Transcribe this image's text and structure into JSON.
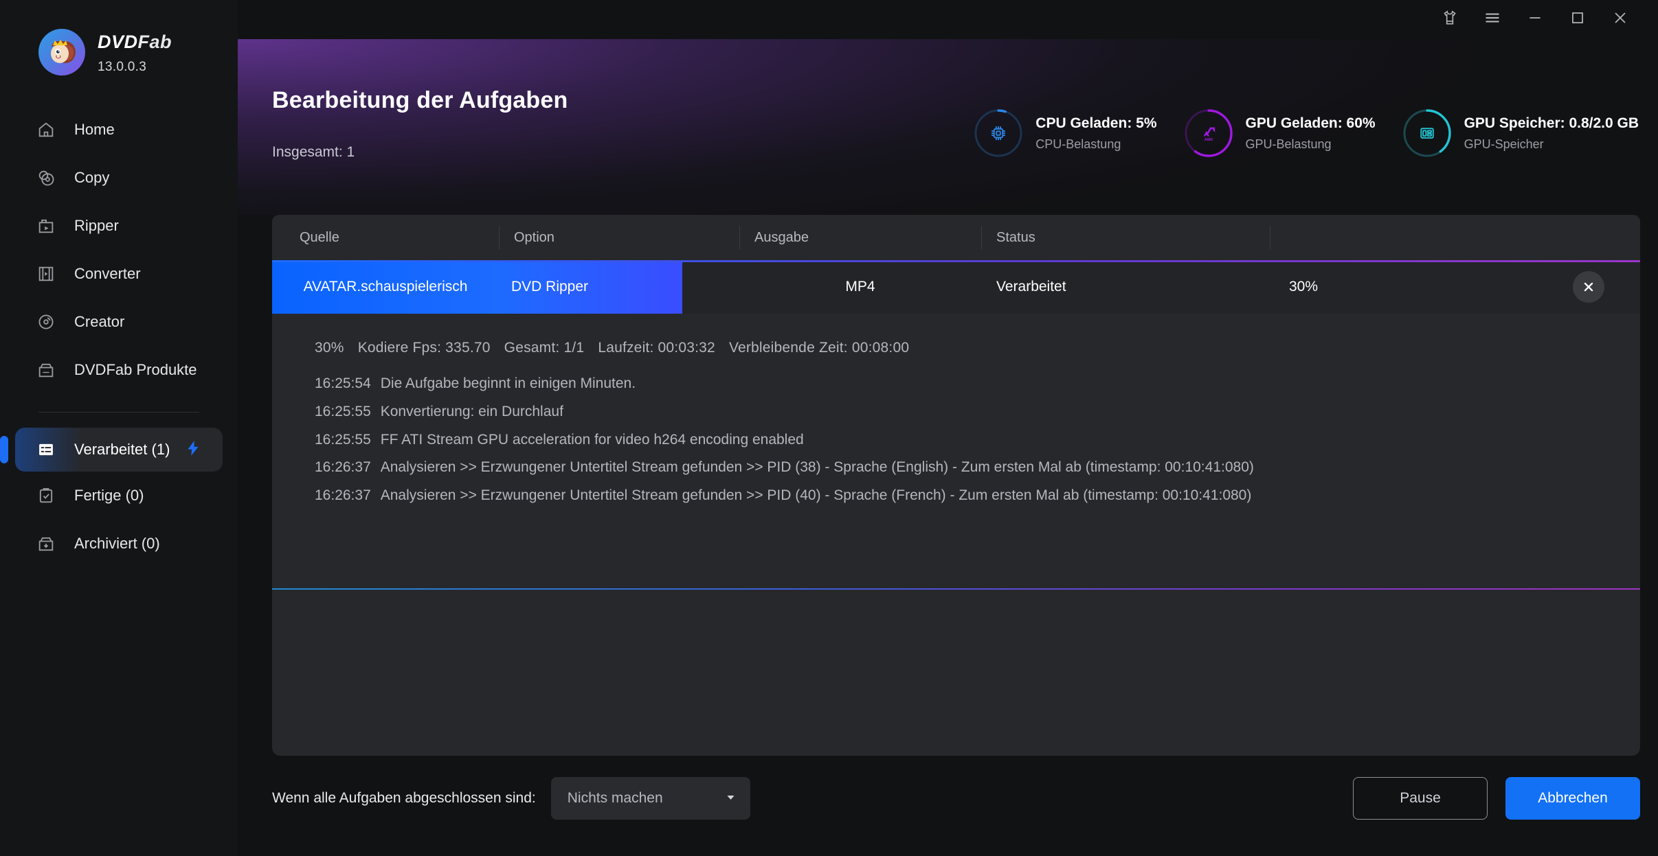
{
  "brand": {
    "name_dvd": "DVD",
    "name_fab": "Fab",
    "version": "13.0.0.3",
    "logo_icon": "monkey-mascot-logo"
  },
  "titlebar": {
    "buttons": [
      {
        "icon": "theme-shirt-icon",
        "name": "theme-button"
      },
      {
        "icon": "hamburger-menu-icon",
        "name": "menu-button"
      },
      {
        "icon": "minimize-icon",
        "name": "minimize-button"
      },
      {
        "icon": "maximize-icon",
        "name": "maximize-button"
      },
      {
        "icon": "close-icon",
        "name": "close-button"
      }
    ]
  },
  "sidebar": {
    "items": [
      {
        "label": "Home",
        "icon": "home-icon"
      },
      {
        "label": "Copy",
        "icon": "disc-copy-icon"
      },
      {
        "label": "Ripper",
        "icon": "ripper-folder-icon"
      },
      {
        "label": "Converter",
        "icon": "film-strip-icon"
      },
      {
        "label": "Creator",
        "icon": "disc-creator-icon"
      },
      {
        "label": "DVDFab Produkte",
        "icon": "products-box-icon"
      }
    ],
    "queue": [
      {
        "label": "Verarbeitet (1)",
        "icon": "processing-list-icon",
        "active": true,
        "badge_icon": "lightning-bolt-icon"
      },
      {
        "label": "Fertige (0)",
        "icon": "clipboard-check-icon",
        "active": false
      },
      {
        "label": "Archiviert (0)",
        "icon": "archive-box-icon",
        "active": false
      }
    ]
  },
  "header": {
    "title": "Bearbeitung der Aufgaben",
    "total": "Insgesamt: 1"
  },
  "stats": [
    {
      "title": "CPU Geladen: 5%",
      "subtitle": "CPU-Belastung",
      "icon": "cpu-chip-icon",
      "percent": 5,
      "color": "#1f6fd0",
      "track": "#1c3350"
    },
    {
      "title": "GPU Geladen: 60%",
      "subtitle": "GPU-Belastung",
      "icon": "amd-gpu-icon",
      "percent": 60,
      "color": "#a018e0",
      "track": "#3a1552"
    },
    {
      "title": "GPU Speicher: 0.8/2.0 GB",
      "subtitle": "GPU-Speicher",
      "icon": "gpu-memory-icon",
      "percent": 40,
      "color": "#23c4d4",
      "track": "#1b4a51"
    }
  ],
  "table": {
    "columns": [
      "Quelle",
      "Option",
      "Ausgabe",
      "Status",
      ""
    ],
    "row": {
      "source": "AVATAR.schauspielerisch",
      "option": "DVD Ripper",
      "output": "MP4",
      "status": "Verarbeitet",
      "progress_label": "30%",
      "progress_percent": 30,
      "close_icon": "close-task-icon"
    }
  },
  "detail": {
    "stats_line": {
      "percent": "30%",
      "fps": "Kodiere Fps: 335.70",
      "total": "Gesamt: 1/1",
      "runtime": "Laufzeit: 00:03:32",
      "remaining": "Verbleibende Zeit: 00:08:00"
    },
    "log": [
      {
        "time": "16:25:54",
        "text": "Die Aufgabe beginnt in einigen Minuten."
      },
      {
        "time": "16:25:55",
        "text": "Konvertierung: ein Durchlauf"
      },
      {
        "time": "16:25:55",
        "text": "FF ATI Stream GPU acceleration for video h264 encoding enabled"
      },
      {
        "time": "16:26:37",
        "text": "Analysieren >> Erzwungener Untertitel Stream gefunden >> PID (38) - Sprache (English) - Zum ersten Mal ab (timestamp: 00:10:41:080)"
      },
      {
        "time": "16:26:37",
        "text": "Analysieren >> Erzwungener Untertitel Stream gefunden >> PID (40) - Sprache (French) - Zum ersten Mal ab (timestamp: 00:10:41:080)"
      }
    ]
  },
  "bottom": {
    "label": "Wenn alle Aufgaben abgeschlossen sind:",
    "select_value": "Nichts machen",
    "select_caret_icon": "chevron-down-icon",
    "pause_label": "Pause",
    "cancel_label": "Abbrechen"
  },
  "colors": {
    "accent_blue": "#1271f5",
    "accent_purple": "#9b35c9",
    "panel": "#27282b",
    "sidebar": "#141517",
    "background": "#111214"
  }
}
